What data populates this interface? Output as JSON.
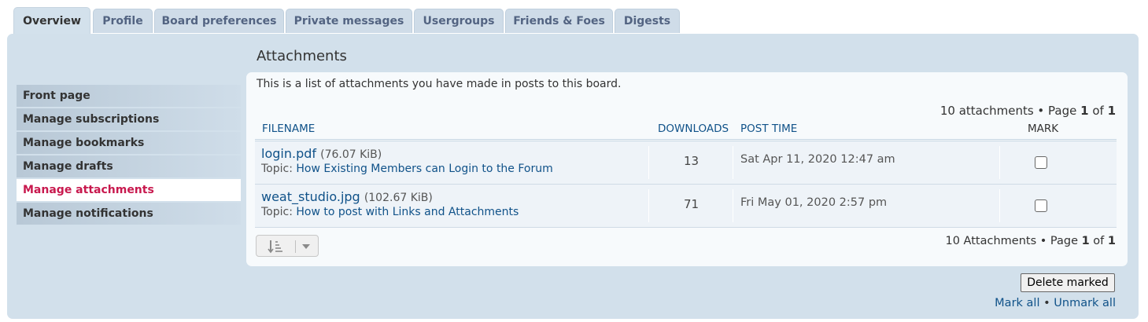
{
  "tabs": [
    {
      "label": "Overview",
      "active": true
    },
    {
      "label": "Profile"
    },
    {
      "label": "Board preferences"
    },
    {
      "label": "Private messages"
    },
    {
      "label": "Usergroups"
    },
    {
      "label": "Friends & Foes"
    },
    {
      "label": "Digests"
    }
  ],
  "sidebar": {
    "items": [
      {
        "label": "Front page"
      },
      {
        "label": "Manage subscriptions"
      },
      {
        "label": "Manage bookmarks"
      },
      {
        "label": "Manage drafts"
      },
      {
        "label": "Manage attachments",
        "active": true
      },
      {
        "label": "Manage notifications"
      }
    ]
  },
  "main": {
    "heading": "Attachments",
    "intro": "This is a list of attachments you have made in posts to this board.",
    "pager_top": {
      "prefix": "10 attachments • Page ",
      "page": "1",
      "of": " of ",
      "total": "1"
    },
    "columns": {
      "filename": "FILENAME",
      "downloads": "DOWNLOADS",
      "post_time": "POST TIME",
      "mark": "MARK"
    },
    "rows": [
      {
        "filename": "login.pdf",
        "size": "(76.07 KiB)",
        "topic_prefix": "Topic: ",
        "topic": "How Existing Members can Login to the Forum",
        "downloads": "13",
        "post_time": "Sat Apr 11, 2020 12:47 am",
        "checked": false
      },
      {
        "filename": "weat_studio.jpg",
        "size": "(102.67 KiB)",
        "topic_prefix": "Topic: ",
        "topic": "How to post with Links and Attachments",
        "downloads": "71",
        "post_time": "Fri May 01, 2020 2:57 pm",
        "checked": false
      }
    ],
    "pager_bottom": {
      "prefix": "10 Attachments • Page ",
      "page": "1",
      "of": " of ",
      "total": "1"
    },
    "sort_icon": "sort-descending-icon",
    "dropdown_icon": "caret-down-icon"
  },
  "actions": {
    "delete_label": "Delete marked",
    "mark_all": "Mark all",
    "separator": "•",
    "unmark_all": "Unmark all"
  },
  "colors": {
    "panel_bg": "#d2e0eb",
    "link": "#105289",
    "active_sidebar": "#c8194e"
  }
}
